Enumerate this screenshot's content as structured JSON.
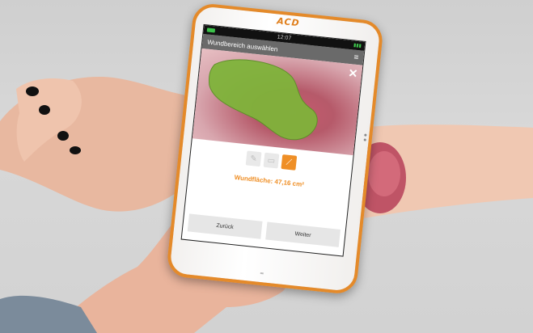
{
  "device": {
    "brand": "ACD",
    "status_time": "12:07",
    "screen_title": "Wundbereich auswählen",
    "wound_area_text": "Wundfläche: 47,16 cm²",
    "back_label": "Zurück",
    "next_label": "Weiter"
  },
  "icons": {
    "menu": "menu-icon",
    "close": "close-icon",
    "tools": [
      "pencil-tool-icon",
      "eraser-tool-icon",
      "line-tool-icon"
    ]
  },
  "colors": {
    "accent": "#ef8f26",
    "frame": "#e48a2a",
    "wound_highlight": "#7fb43a"
  }
}
